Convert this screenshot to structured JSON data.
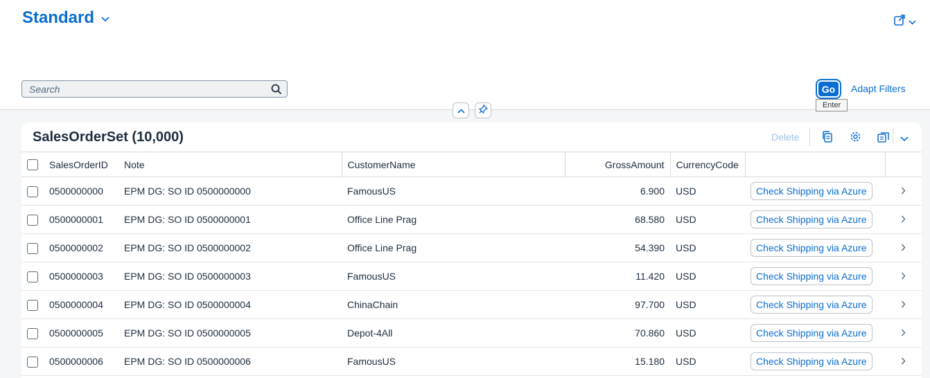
{
  "header": {
    "variant_title": "Standard",
    "search_placeholder": "Search",
    "go_label": "Go",
    "go_tooltip": "Enter",
    "adapt_filters_label": "Adapt Filters"
  },
  "table": {
    "title": "SalesOrderSet (10,000)",
    "delete_label": "Delete",
    "columns": [
      "SalesOrderID",
      "Note",
      "CustomerName",
      "GrossAmount",
      "CurrencyCode"
    ],
    "action_label": "Check Shipping via Azure",
    "rows": [
      {
        "id": "0500000000",
        "note": "EPM DG: SO ID 0500000000",
        "customer": "FamousUS",
        "amount": "6.900",
        "currency": "USD"
      },
      {
        "id": "0500000001",
        "note": "EPM DG: SO ID 0500000001",
        "customer": "Office Line Prag",
        "amount": "68.580",
        "currency": "USD"
      },
      {
        "id": "0500000002",
        "note": "EPM DG: SO ID 0500000002",
        "customer": "Office Line Prag",
        "amount": "54.390",
        "currency": "USD"
      },
      {
        "id": "0500000003",
        "note": "EPM DG: SO ID 0500000003",
        "customer": "FamousUS",
        "amount": "11.420",
        "currency": "USD"
      },
      {
        "id": "0500000004",
        "note": "EPM DG: SO ID 0500000004",
        "customer": "ChinaChain",
        "amount": "97.700",
        "currency": "USD"
      },
      {
        "id": "0500000005",
        "note": "EPM DG: SO ID 0500000005",
        "customer": "Depot-4All",
        "amount": "70.860",
        "currency": "USD"
      },
      {
        "id": "0500000006",
        "note": "EPM DG: SO ID 0500000006",
        "customer": "FamousUS",
        "amount": "15.180",
        "currency": "USD"
      }
    ]
  },
  "colors": {
    "accent": "#0a6ed1",
    "text": "#1d2d3e",
    "background": "#f5f6f7"
  },
  "icons": [
    "chevron-down-icon",
    "share-icon",
    "search-icon",
    "collapse-up-icon",
    "pin-icon",
    "copy-icon",
    "gear-icon",
    "export-icon",
    "chevron-right-icon"
  ]
}
